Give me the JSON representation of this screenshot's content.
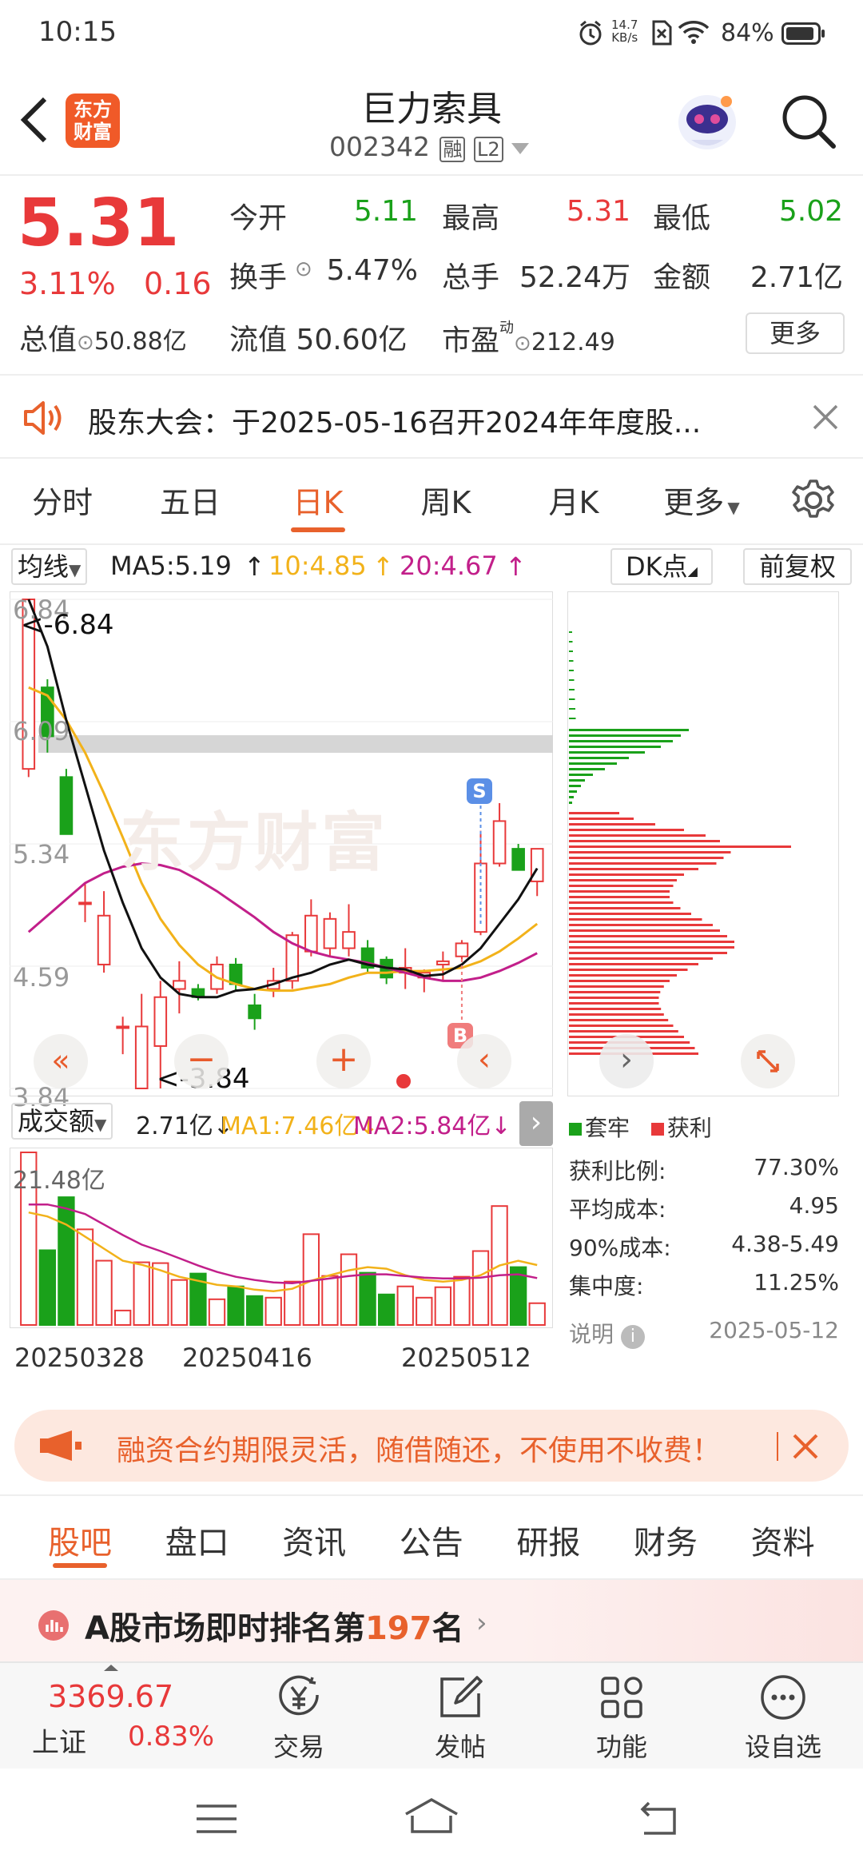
{
  "status_bar": {
    "time": "10:15",
    "net_speed_value": "14.7",
    "net_speed_unit": "KB/s",
    "battery": "84%"
  },
  "header": {
    "logo_text": "东方财富",
    "title": "巨力索具",
    "code": "002342",
    "tag_rong": "融",
    "tag_l2": "L2"
  },
  "quote": {
    "price": "5.31",
    "change_pct": "3.11%",
    "change": "0.16",
    "rows": [
      [
        {
          "label": "今开",
          "value": "5.11",
          "color": "green"
        },
        {
          "label": "最高",
          "value": "5.31",
          "color": "red"
        },
        {
          "label": "最低",
          "value": "5.02",
          "color": "green"
        }
      ],
      [
        {
          "label": "换手",
          "value": "5.47%",
          "color": "dark"
        },
        {
          "label": "总手",
          "value": "52.24万",
          "color": "dark"
        },
        {
          "label": "金额",
          "value": "2.71亿",
          "color": "dark"
        }
      ]
    ],
    "total_value_label": "总值",
    "total_value": "50.88亿",
    "float_value_label": "流值",
    "float_value": "50.60亿",
    "pe_label": "市盈",
    "pe_sup": "动",
    "pe_value": "212.49",
    "more_button": "更多"
  },
  "notice": {
    "text": "股东大会：于2025-05-16召开2024年年度股..."
  },
  "chart_tabs": {
    "items": [
      "分时",
      "五日",
      "日K",
      "周K",
      "月K",
      "更多"
    ],
    "active": 2
  },
  "ma_bar": {
    "selector": "均线",
    "ma5": "MA5:5.19",
    "ma10": "10:4.85",
    "ma20": "20:4.67",
    "dk_button": "DK点",
    "fq_button": "前复权"
  },
  "kline": {
    "y_labels": [
      "6.84",
      "6.09",
      "5.34",
      "4.59",
      "3.84"
    ],
    "high_marker": "<-6.84",
    "low_marker": "<-3.84",
    "watermark": "东方财富",
    "s_badge": "S",
    "b_badge": "B"
  },
  "volume": {
    "selector": "成交额",
    "value": "2.71亿",
    "ma1": "MA1:7.46亿",
    "ma2": "MA2:5.84亿",
    "max_label": "21.48亿",
    "dates": [
      "20250328",
      "20250416",
      "20250512"
    ]
  },
  "chip": {
    "legend_tao": "套牢",
    "legend_huo": "获利",
    "stats": [
      {
        "label": "获利比例:",
        "value": "77.30%"
      },
      {
        "label": "平均成本:",
        "value": "4.95"
      },
      {
        "label": "90%成本:",
        "value": "4.38-5.49"
      },
      {
        "label": "集中度:",
        "value": "11.25%"
      }
    ],
    "explain": "说明",
    "date": "2025-05-12"
  },
  "promo": {
    "text": "融资合约期限灵活，随借随还，不使用不收费！"
  },
  "bottom_tabs": {
    "items": [
      "股吧",
      "盘口",
      "资讯",
      "公告",
      "研报",
      "财务",
      "资料"
    ],
    "active": 0
  },
  "ranking": {
    "prefix": "A股市场即时排名第",
    "rank": "197",
    "suffix": "名"
  },
  "nav": {
    "index_value": "3369.67",
    "index_name": "上证",
    "index_change": "0.83%",
    "items": [
      "交易",
      "发帖",
      "功能",
      "设自选"
    ]
  },
  "chart_data": {
    "type": "candlestick",
    "ylim": [
      3.84,
      6.84
    ],
    "y_ticks": [
      6.84,
      6.09,
      5.34,
      4.59,
      3.84
    ],
    "x_labels": [
      "20250328",
      "20250416",
      "20250512"
    ],
    "candles": [
      [
        5.8,
        6.84,
        5.75,
        6.84
      ],
      [
        6.3,
        6.35,
        5.9,
        6.0
      ],
      [
        5.75,
        5.8,
        5.4,
        5.4
      ],
      [
        4.98,
        5.1,
        4.86,
        4.98
      ],
      [
        4.6,
        5.05,
        4.55,
        4.9
      ],
      [
        4.22,
        4.28,
        4.05,
        4.22
      ],
      [
        3.84,
        4.42,
        3.84,
        4.22
      ],
      [
        4.1,
        4.5,
        3.84,
        4.4
      ],
      [
        4.45,
        4.62,
        4.3,
        4.5
      ],
      [
        4.45,
        4.48,
        4.38,
        4.4
      ],
      [
        4.45,
        4.65,
        4.42,
        4.6
      ],
      [
        4.6,
        4.64,
        4.44,
        4.48
      ],
      [
        4.35,
        4.42,
        4.2,
        4.27
      ],
      [
        4.45,
        4.58,
        4.4,
        4.5
      ],
      [
        4.5,
        4.8,
        4.45,
        4.78
      ],
      [
        4.68,
        5.0,
        4.65,
        4.9
      ],
      [
        4.7,
        4.92,
        4.65,
        4.88
      ],
      [
        4.7,
        4.97,
        4.65,
        4.8
      ],
      [
        4.7,
        4.75,
        4.55,
        4.58
      ],
      [
        4.63,
        4.65,
        4.48,
        4.52
      ],
      [
        4.55,
        4.7,
        4.45,
        4.58
      ],
      [
        4.52,
        4.57,
        4.43,
        4.55
      ],
      [
        4.6,
        4.68,
        4.5,
        4.62
      ],
      [
        4.65,
        4.75,
        4.62,
        4.73
      ],
      [
        4.8,
        5.42,
        4.78,
        5.22
      ],
      [
        5.22,
        5.59,
        5.2,
        5.48
      ],
      [
        5.31,
        5.34,
        5.18,
        5.18
      ],
      [
        5.11,
        5.31,
        5.02,
        5.31
      ]
    ],
    "ma5": [
      6.84,
      6.55,
      6.1,
      5.7,
      5.3,
      4.98,
      4.7,
      4.52,
      4.42,
      4.4,
      4.4,
      4.44,
      4.45,
      4.48,
      4.52,
      4.55,
      4.6,
      4.63,
      4.6,
      4.58,
      4.57,
      4.53,
      4.54,
      4.6,
      4.7,
      4.85,
      5.0,
      5.19
    ],
    "ma10": [
      6.3,
      6.25,
      6.1,
      5.9,
      5.65,
      5.38,
      5.1,
      4.88,
      4.72,
      4.6,
      4.52,
      4.48,
      4.45,
      4.44,
      4.44,
      4.46,
      4.48,
      4.52,
      4.55,
      4.55,
      4.56,
      4.56,
      4.57,
      4.58,
      4.62,
      4.68,
      4.76,
      4.85
    ],
    "ma20": [
      4.8,
      4.9,
      5.0,
      5.1,
      5.16,
      5.2,
      5.22,
      5.21,
      5.18,
      5.12,
      5.05,
      4.97,
      4.89,
      4.8,
      4.73,
      4.68,
      4.65,
      4.63,
      4.61,
      4.58,
      4.55,
      4.52,
      4.5,
      4.5,
      4.52,
      4.56,
      4.61,
      4.67
    ],
    "chip_red": [
      70,
      90,
      120,
      160,
      190,
      210,
      220,
      225,
      215,
      205,
      180,
      160,
      150,
      145,
      140,
      140,
      145,
      155,
      170,
      185,
      200,
      210,
      220,
      230,
      230,
      220,
      200,
      180,
      165,
      150,
      140,
      132,
      127,
      125,
      125,
      128,
      132,
      138,
      145,
      152,
      160,
      168,
      175,
      180
    ],
    "chip_green": [
      150,
      140,
      130,
      115,
      95,
      75,
      60,
      45,
      30,
      20,
      15,
      10,
      6,
      4
    ]
  }
}
